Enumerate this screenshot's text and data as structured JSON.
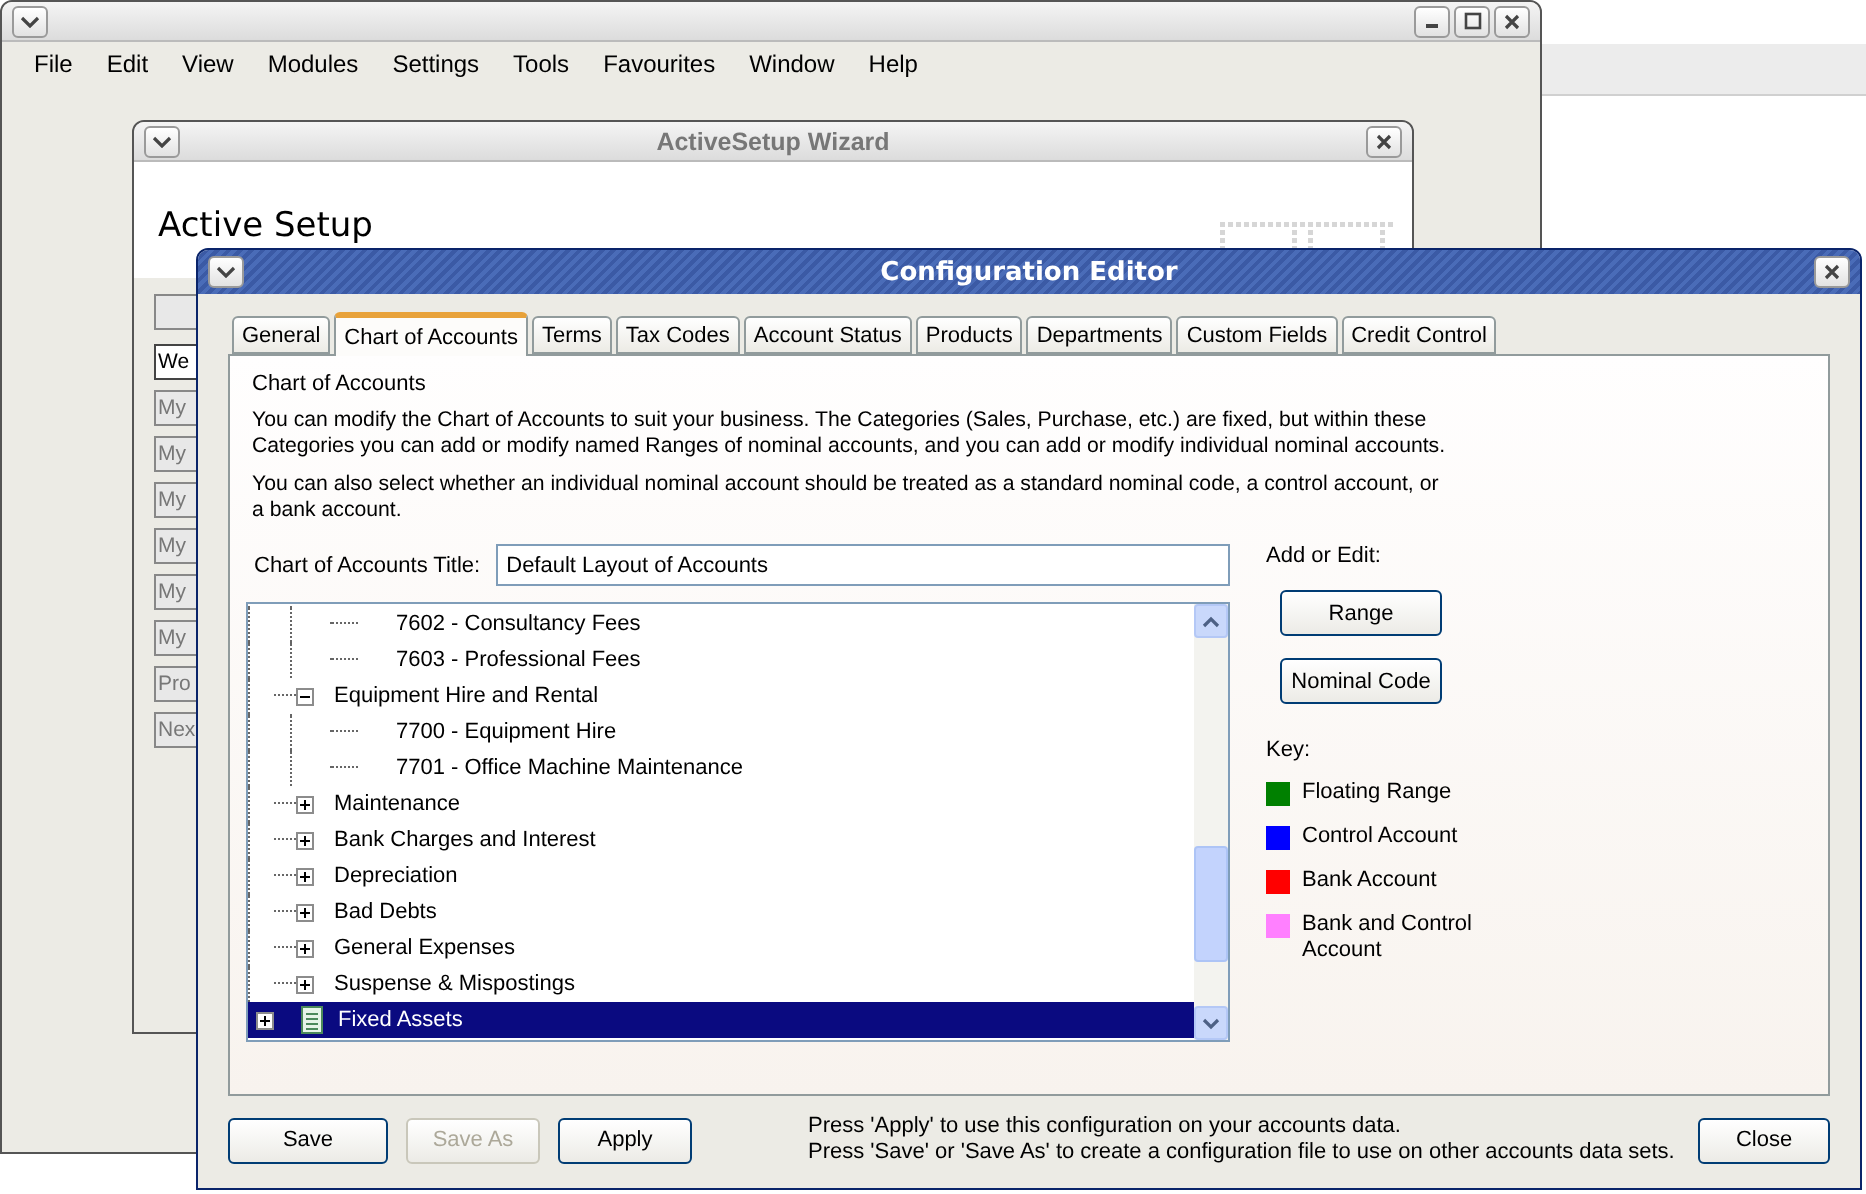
{
  "main_window": {
    "menu": [
      "File",
      "Edit",
      "View",
      "Modules",
      "Settings",
      "Tools",
      "Favourites",
      "Window",
      "Help"
    ]
  },
  "wizard": {
    "title": "ActiveSetup Wizard",
    "heading": "Active Setup",
    "side_buttons": [
      "We",
      "My",
      "My",
      "My",
      "My",
      "My",
      "My",
      "Pro",
      "Nex"
    ]
  },
  "editor": {
    "title": "Configuration Editor",
    "tabs": [
      {
        "label": "General",
        "selected": false
      },
      {
        "label": "Chart of Accounts",
        "selected": true
      },
      {
        "label": "Terms",
        "selected": false
      },
      {
        "label": "Tax Codes",
        "selected": false
      },
      {
        "label": "Account Status",
        "selected": false
      },
      {
        "label": "Products",
        "selected": false
      },
      {
        "label": "Departments",
        "selected": false
      },
      {
        "label": "Custom Fields",
        "selected": false
      },
      {
        "label": "Credit Control",
        "selected": false
      }
    ],
    "section_title": "Chart of Accounts",
    "paragraphs": [
      "You can modify the Chart of Accounts to suit your business. The Categories (Sales, Purchase, etc.) are fixed, but within these Categories you can add or modify named Ranges of nominal accounts, and you can add or modify individual nominal accounts.",
      "You can also select whether an individual nominal account should be treated as a standard nominal code, a control account, or a bank account."
    ],
    "title_field": {
      "label": "Chart of Accounts Title:",
      "value": "Default Layout of Accounts"
    },
    "tree": [
      {
        "children": [
          {
            "children": [
              {
                "label": "7602 - Consultancy Fees",
                "selected": false
              },
              {
                "label": "7603 - Professional Fees",
                "selected": false
              }
            ]
          },
          {
            "label": "Equipment Hire and Rental",
            "expanded": true,
            "selected": false,
            "children": [
              {
                "label": "7700 - Equipment Hire",
                "selected": false
              },
              {
                "label": "7701 - Office Machine Maintenance",
                "selected": false
              }
            ]
          },
          {
            "label": "Maintenance",
            "expanded": false,
            "selected": false
          },
          {
            "label": "Bank Charges and Interest",
            "expanded": false,
            "selected": false
          },
          {
            "label": "Depreciation",
            "expanded": false,
            "selected": false
          },
          {
            "label": "Bad Debts",
            "expanded": false,
            "selected": false
          },
          {
            "label": "General Expenses",
            "expanded": false,
            "selected": false
          },
          {
            "label": "Suspense & Mispostings",
            "expanded": false,
            "selected": false
          }
        ]
      },
      {
        "label": "Fixed Assets",
        "expanded": false,
        "selected": true
      }
    ],
    "add_edit_label": "Add or Edit:",
    "side_buttons": [
      "Range",
      "Nominal Code"
    ],
    "key_label": "Key:",
    "key": [
      {
        "label": "Floating Range",
        "color": "#008000"
      },
      {
        "label": "Control Account",
        "color": "#0000ff"
      },
      {
        "label": "Bank Account",
        "color": "#ff0000"
      },
      {
        "label": "Bank and Control Account",
        "color": "#ff80ff"
      }
    ],
    "footer_buttons": [
      {
        "label": "Save",
        "disabled": false
      },
      {
        "label": "Save As",
        "disabled": true
      },
      {
        "label": "Apply",
        "disabled": false
      }
    ],
    "footer_note": [
      "Press 'Apply' to use this configuration on your accounts data.",
      "Press 'Save' or 'Save As' to create a configuration file to use on other accounts data sets."
    ],
    "close_button": "Close"
  }
}
